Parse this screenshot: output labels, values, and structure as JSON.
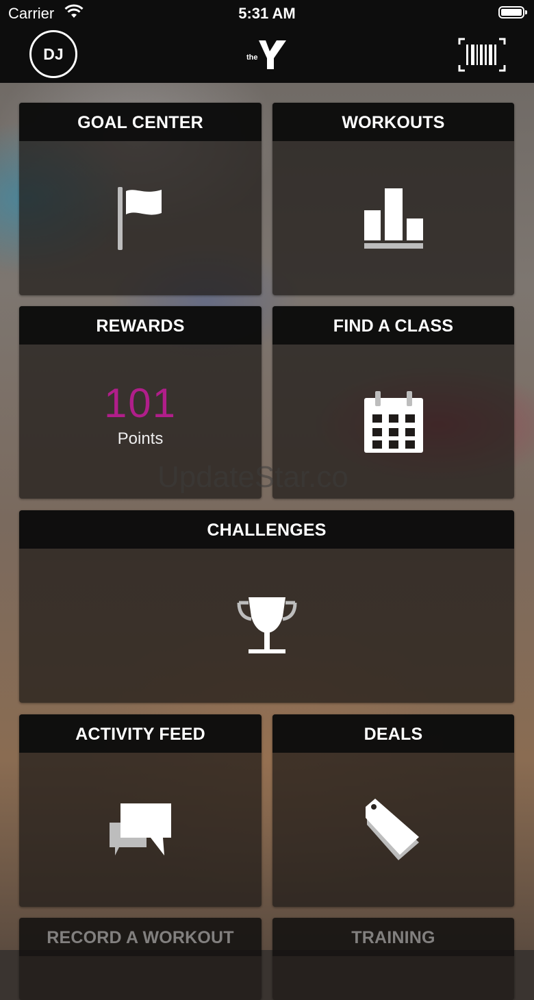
{
  "status_bar": {
    "carrier": "Carrier",
    "time": "5:31 AM"
  },
  "header": {
    "avatar_initials": "DJ",
    "logo_icon": "ymca-logo",
    "barcode_icon": "barcode-icon"
  },
  "tiles": {
    "goal_center": {
      "label": "GOAL CENTER",
      "icon": "flag-icon"
    },
    "workouts": {
      "label": "WORKOUTS",
      "icon": "bar-chart-icon"
    },
    "rewards": {
      "label": "REWARDS",
      "points": "101",
      "points_label": "Points"
    },
    "find_a_class": {
      "label": "FIND A CLASS",
      "icon": "calendar-icon"
    },
    "challenges": {
      "label": "CHALLENGES",
      "icon": "trophy-icon"
    },
    "activity_feed": {
      "label": "ACTIVITY FEED",
      "icon": "chat-bubbles-icon"
    },
    "deals": {
      "label": "DEALS",
      "icon": "tag-icon"
    },
    "record_a_workout": {
      "label": "RECORD A WORKOUT"
    },
    "training": {
      "label": "TRAINING"
    }
  },
  "watermark": "UpdateStar.co",
  "colors": {
    "accent_points": "#b01e8a",
    "topbar": "#0d0d0d"
  }
}
